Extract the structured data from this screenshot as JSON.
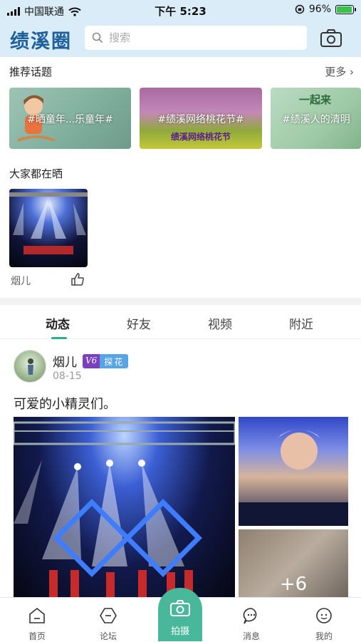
{
  "status_bar": {
    "carrier": "中国联通",
    "time": "下午 5:23",
    "battery": "96%",
    "battery_level": 0.96
  },
  "header": {
    "logo": "绩溪圈",
    "search_placeholder": "搜索"
  },
  "topics": {
    "title": "推荐话题",
    "more": "更多",
    "items": [
      {
        "label": "#晒童年...乐童年#"
      },
      {
        "label": "#绩溪网络桃花节#",
        "sub": "绩溪网络桃花节"
      },
      {
        "label": "#绩溪人的清明",
        "heading": "一起来"
      }
    ]
  },
  "shares": {
    "title": "大家都在晒",
    "items": [
      {
        "name": "烟儿"
      }
    ]
  },
  "tabs": [
    {
      "label": "动态"
    },
    {
      "label": "好友"
    },
    {
      "label": "视频"
    },
    {
      "label": "附近"
    }
  ],
  "post": {
    "user": "烟儿",
    "level": "V6",
    "tag": "探花",
    "date": "08-15",
    "text": "可爱的小精灵们。",
    "more_images": "+6"
  },
  "nav": [
    {
      "label": "首页",
      "icon": "home-icon"
    },
    {
      "label": "论坛",
      "icon": "forum-icon"
    },
    {
      "label": "拍摄",
      "icon": "camera-icon"
    },
    {
      "label": "消息",
      "icon": "message-icon"
    },
    {
      "label": "我的",
      "icon": "profile-icon"
    }
  ],
  "colors": {
    "accent": "#2ab08e",
    "header_bg": "#d9ecf8",
    "logo": "#1e5f9c",
    "level_badge": "#7a3fbf",
    "tag_badge": "#56a3e6"
  }
}
